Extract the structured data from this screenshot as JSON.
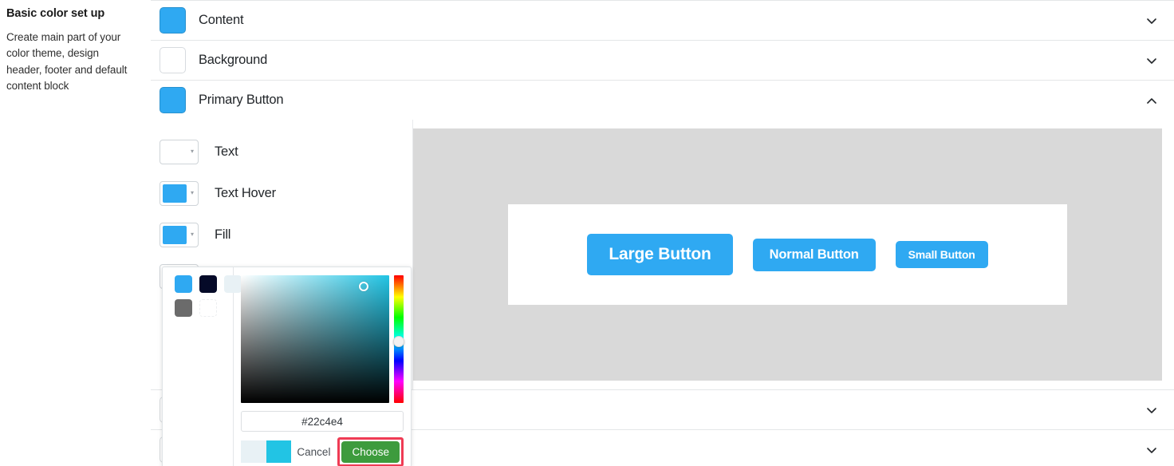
{
  "sidebar": {
    "title": "Basic color set up",
    "description": "Create main part of your color theme, design header, footer and default content block"
  },
  "accordion": {
    "items": [
      {
        "label": "Content",
        "swatch_color": "#2fa9f2",
        "state": "collapsed",
        "chevron": "chevron-down-icon"
      },
      {
        "label": "Background",
        "swatch_color": "#ffffff",
        "state": "collapsed",
        "chevron": "chevron-down-icon"
      },
      {
        "label": "Primary Button",
        "swatch_color": "#2fa9f2",
        "state": "expanded",
        "chevron": "chevron-up-icon"
      }
    ],
    "bottom_items": [
      {
        "label": "",
        "swatch_color": "#ffffff",
        "state": "collapsed",
        "chevron": "chevron-down-icon"
      },
      {
        "label": "",
        "swatch_color": "#ffffff",
        "state": "collapsed",
        "chevron": "chevron-down-icon"
      }
    ]
  },
  "sub_settings": [
    {
      "label": "Text",
      "color": "#ffffff",
      "caret": "caret-down-icon"
    },
    {
      "label": "Text Hover",
      "color": "#2fa9f2",
      "caret": "caret-down-icon"
    },
    {
      "label": "Fill",
      "color": "#2fa9f2",
      "caret": "caret-down-icon"
    }
  ],
  "preview": {
    "background_color": "#d9d9d9",
    "card_color": "#ffffff",
    "buttons": [
      {
        "label": "Large Button",
        "size": "large",
        "color": "#2fa9f2"
      },
      {
        "label": "Normal Button",
        "size": "normal",
        "color": "#2fa9f2"
      },
      {
        "label": "Small Button",
        "size": "small",
        "color": "#2fa9f2"
      }
    ]
  },
  "color_picker": {
    "swatches": [
      {
        "color": "#2fa9f2",
        "name": "swatch-blue"
      },
      {
        "color": "#050a28",
        "name": "swatch-dark-navy"
      },
      {
        "color": "#e8f1f5",
        "name": "swatch-pale-blue"
      },
      {
        "color": "#6b6b6b",
        "name": "swatch-gray"
      },
      {
        "color": "",
        "name": "swatch-empty"
      }
    ],
    "hex_value": "#22c4e4",
    "hex_placeholder": "#22c4e4",
    "selected_color": "#22c4e4",
    "previous_color": "#e8f1f5",
    "cancel_label": "Cancel",
    "choose_label": "Choose",
    "highlight_color": "#ef3b54",
    "choose_button_color": "#3d9b3d"
  }
}
